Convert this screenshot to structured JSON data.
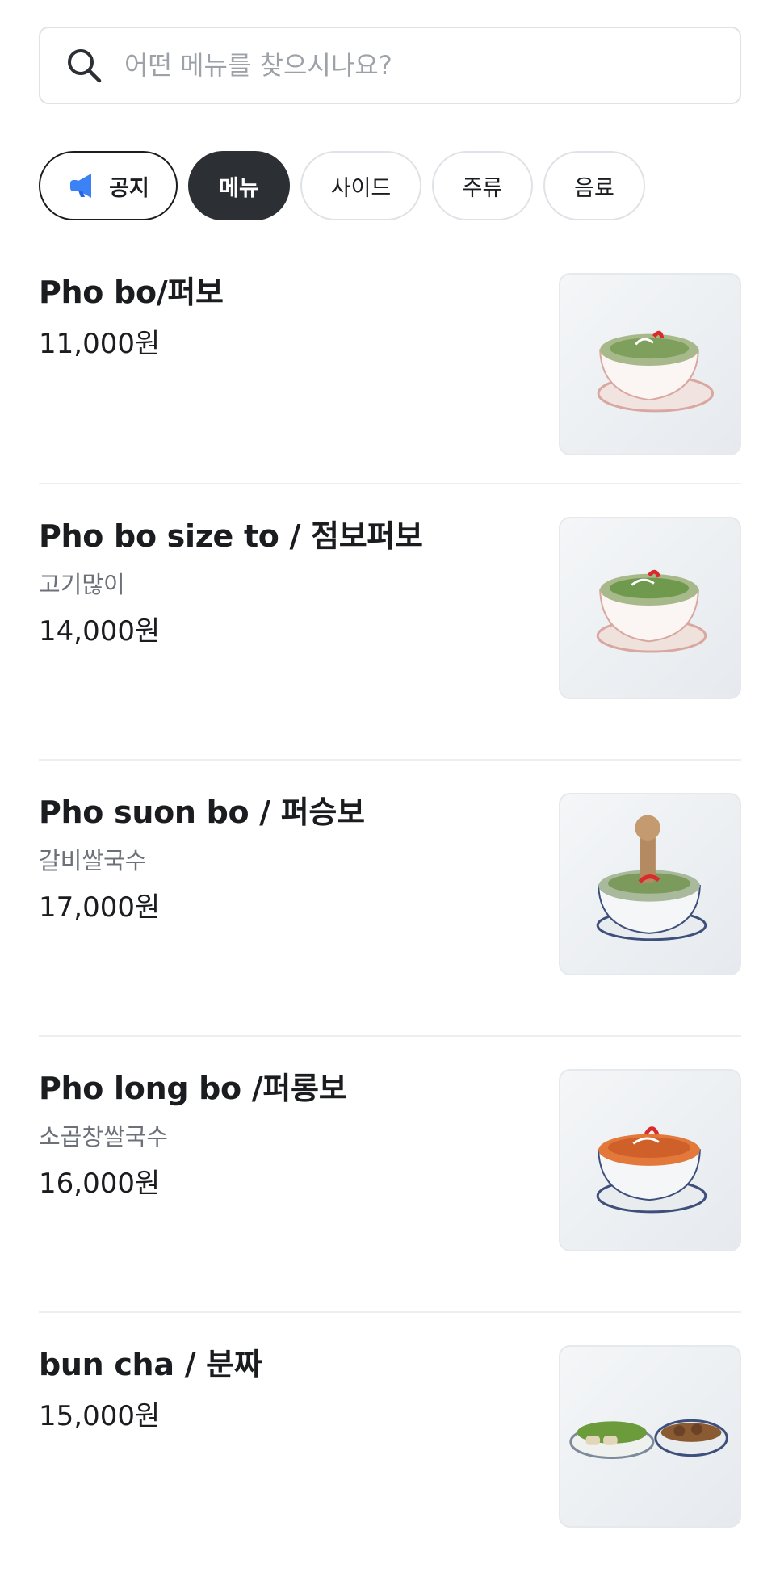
{
  "search": {
    "placeholder": "어떤 메뉴를 찾으시나요?",
    "icon": "search-icon"
  },
  "categories": [
    {
      "label": "공지",
      "icon": "megaphone-icon",
      "state": "outlined"
    },
    {
      "label": "메뉴",
      "state": "active"
    },
    {
      "label": "사이드",
      "state": "default"
    },
    {
      "label": "주류",
      "state": "default"
    },
    {
      "label": "음료",
      "state": "default"
    }
  ],
  "menu": {
    "items": [
      {
        "name": "Pho bo/퍼보",
        "description": "",
        "price": "11,000원",
        "image": "pho-bo-bowl"
      },
      {
        "name": "Pho bo size to / 점보퍼보",
        "description": "고기많이",
        "price": "14,000원",
        "image": "pho-bo-jumbo-bowl"
      },
      {
        "name": "Pho suon bo / 퍼승보",
        "description": "갈비쌀국수",
        "price": "17,000원",
        "image": "pho-suon-bo-bowl"
      },
      {
        "name": "Pho long bo /퍼롱보",
        "description": "소곱창쌀국수",
        "price": "16,000원",
        "image": "pho-long-bo-bowl"
      },
      {
        "name": "bun cha / 분짜",
        "description": "",
        "price": "15,000원",
        "image": "bun-cha-plates"
      }
    ]
  },
  "colors": {
    "active_chip_bg": "#2c2f34",
    "border": "#dfe2e6",
    "placeholder": "#9da2a9",
    "description": "#6b7079",
    "megaphone": "#3b82f6"
  }
}
